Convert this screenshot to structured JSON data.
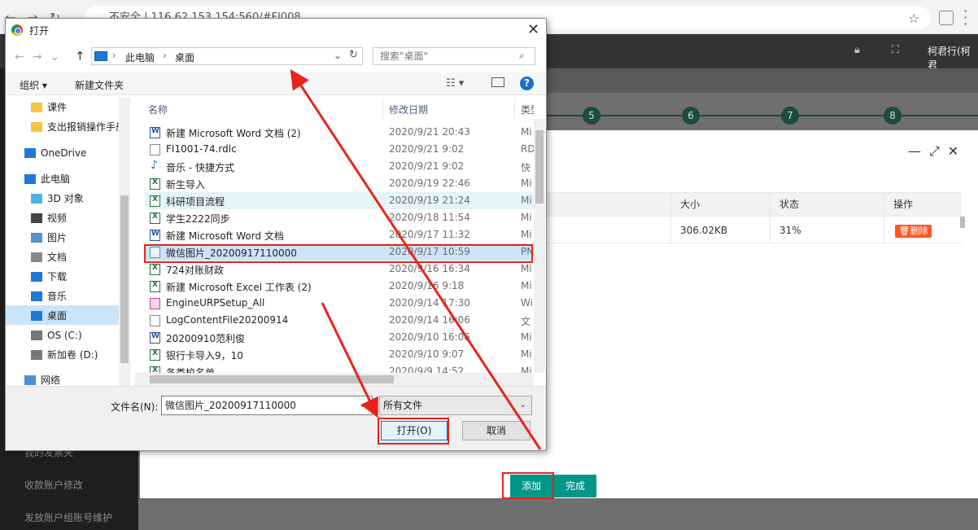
{
  "browser": {
    "address": "不安全 | 116.62.153.154:560/#FI008"
  },
  "app_header": {
    "user": "柯君行(柯君"
  },
  "sidebar": {
    "items": [
      "我的发票夹",
      "收款账户修改",
      "发放账户组账号维护"
    ]
  },
  "steps": [
    "5",
    "6",
    "7",
    "8"
  ],
  "upload": {
    "columns": {
      "size": "大小",
      "status": "状态",
      "action": "操作"
    },
    "row": {
      "size": "306.02KB",
      "status": "31%",
      "delete": "删除"
    },
    "add_label": "添加",
    "done_label": "完成"
  },
  "dialog": {
    "title": "打开",
    "breadcrumb": [
      "此电脑",
      "桌面"
    ],
    "search_placeholder": "搜索\"桌面\"",
    "toolbar": {
      "organize": "组织 ▾",
      "new_folder": "新建文件夹"
    },
    "nav": [
      {
        "label": "课件",
        "icon": "folder-icon"
      },
      {
        "label": "支出报销操作手册",
        "icon": "folder-icon"
      },
      {
        "label": "OneDrive",
        "icon": "cloud-icon"
      },
      {
        "label": "此电脑",
        "icon": "computer-icon"
      },
      {
        "label": "3D 对象",
        "icon": "cube-icon"
      },
      {
        "label": "视频",
        "icon": "video-icon"
      },
      {
        "label": "图片",
        "icon": "picture-icon"
      },
      {
        "label": "文档",
        "icon": "document-icon"
      },
      {
        "label": "下载",
        "icon": "download-icon"
      },
      {
        "label": "音乐",
        "icon": "music-icon"
      },
      {
        "label": "桌面",
        "icon": "desktop-icon"
      },
      {
        "label": "OS (C:)",
        "icon": "drive-icon"
      },
      {
        "label": "新加卷 (D:)",
        "icon": "drive-icon"
      },
      {
        "label": "网络",
        "icon": "network-icon"
      }
    ],
    "columns": {
      "name": "名称",
      "date": "修改日期",
      "type": "类型"
    },
    "files": [
      {
        "name": "新建 Microsoft Word 文档 (2)",
        "date": "2020/9/21 20:43",
        "type": "Mi",
        "icon": "word"
      },
      {
        "name": "FI1001-74.rdlc",
        "date": "2020/9/21 9:02",
        "type": "RD",
        "icon": "doc"
      },
      {
        "name": "音乐 - 快捷方式",
        "date": "2020/9/21 9:02",
        "type": "快",
        "icon": "mus"
      },
      {
        "name": "新生导入",
        "date": "2020/9/19 22:46",
        "type": "Mi",
        "icon": "xls"
      },
      {
        "name": "科研项目流程",
        "date": "2020/9/19 21:24",
        "type": "Mi",
        "icon": "xls"
      },
      {
        "name": "学生2222同步",
        "date": "2020/9/18 11:54",
        "type": "Mi",
        "icon": "xls"
      },
      {
        "name": "新建 Microsoft Word 文档",
        "date": "2020/9/17 11:32",
        "type": "Mi",
        "icon": "word"
      },
      {
        "name": "微信图片_20200917110000",
        "date": "2020/9/17 10:59",
        "type": "PN",
        "icon": "img"
      },
      {
        "name": "724对账财政",
        "date": "2020/9/16 16:34",
        "type": "Mi",
        "icon": "xls"
      },
      {
        "name": "新建 Microsoft Excel 工作表 (2)",
        "date": "2020/9/16 9:18",
        "type": "Mi",
        "icon": "xls"
      },
      {
        "name": "EngineURPSetup_All",
        "date": "2020/9/14 17:30",
        "type": "Wi",
        "icon": "app"
      },
      {
        "name": "LogContentFile20200914",
        "date": "2020/9/14 16:06",
        "type": "文",
        "icon": "doc"
      },
      {
        "name": "20200910范利俊",
        "date": "2020/9/10 16:06",
        "type": "Mi",
        "icon": "word"
      },
      {
        "name": "银行卡导入9，10",
        "date": "2020/9/10 9:07",
        "type": "Mi",
        "icon": "xls"
      },
      {
        "name": "各类校名单",
        "date": "2020/9/9 14:52",
        "type": "Mi",
        "icon": "xls"
      }
    ],
    "filename_label": "文件名(N):",
    "filename_value": "微信图片_20200917110000",
    "filetype_value": "所有文件",
    "open_label": "打开(O)",
    "cancel_label": "取消"
  },
  "colors": {
    "teal": "#009688",
    "annotation_red": "#e8231b",
    "selection": "#cce4f7"
  }
}
